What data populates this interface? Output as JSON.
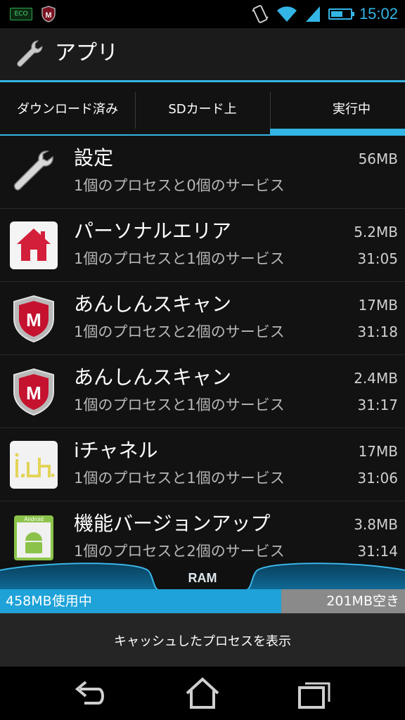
{
  "status_bar": {
    "eco_label": "ECO",
    "time": "15:02",
    "icons": [
      "eco-icon",
      "mcafee-icon",
      "vibrate-icon",
      "wifi-icon",
      "signal-icon",
      "battery-icon"
    ]
  },
  "action_bar": {
    "title": "アプリ",
    "icon": "wrench-icon"
  },
  "tabs": [
    {
      "label": "ダウンロード済み",
      "active": false
    },
    {
      "label": "SDカード上",
      "active": false
    },
    {
      "label": "実行中",
      "active": true
    }
  ],
  "apps": [
    {
      "name": "設定",
      "desc": "1個のプロセスと0個のサービス",
      "memory": "56MB",
      "time": "",
      "icon": "settings-wrench-icon"
    },
    {
      "name": "パーソナルエリア",
      "desc": "1個のプロセスと1個のサービス",
      "memory": "5.2MB",
      "time": "31:05",
      "icon": "personal-area-house-icon"
    },
    {
      "name": "あんしんスキャン",
      "desc": "1個のプロセスと2個のサービス",
      "memory": "17MB",
      "time": "31:18",
      "icon": "mcafee-shield-icon"
    },
    {
      "name": "あんしんスキャン",
      "desc": "1個のプロセスと1個のサービス",
      "memory": "2.4MB",
      "time": "31:17",
      "icon": "mcafee-shield-icon"
    },
    {
      "name": "iチャネル",
      "desc": "1個のプロセスと1個のサービス",
      "memory": "17MB",
      "time": "31:06",
      "icon": "ichannel-icon"
    },
    {
      "name": "機能バージョンアップ",
      "desc": "1個のプロセスと2個のサービス",
      "memory": "3.8MB",
      "time": "31:14",
      "icon": "android-update-icon"
    }
  ],
  "ram": {
    "label": "RAM",
    "used_text": "458MB使用中",
    "free_text": "201MB空き",
    "used_fraction": 0.695,
    "used_color": "#1ea2d8",
    "free_color": "#8a8a8a"
  },
  "cache_button": {
    "label": "キャッシュしたプロセスを表示"
  },
  "nav": {
    "icons": [
      "back-icon",
      "home-icon",
      "recent-apps-icon"
    ]
  },
  "colors": {
    "accent": "#33b5e5"
  }
}
